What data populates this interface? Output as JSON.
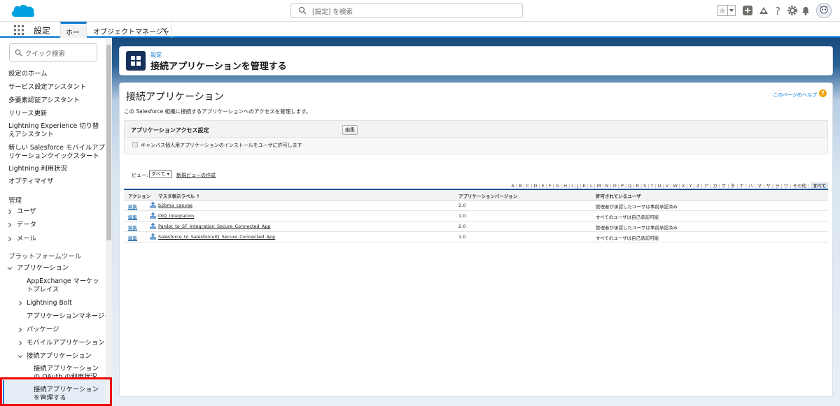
{
  "topbar": {
    "search_placeholder": "[設定] を検索"
  },
  "navbar": {
    "app_name": "設定",
    "tabs": [
      {
        "label": "ホーム"
      },
      {
        "label": "オブジェクトマネージャ"
      }
    ]
  },
  "sidebar": {
    "quick_find_placeholder": "クイック検索",
    "items": [
      {
        "label": "設定のホーム"
      },
      {
        "label": "サービス設定アシスタント"
      },
      {
        "label": "多要素認証アシスタント"
      },
      {
        "label": "リリース更新"
      },
      {
        "label": "Lightning Experience 切り替えアシスタント"
      },
      {
        "label": "新しい Salesforce モバイルアプリケーションクイックスタート"
      },
      {
        "label": "Lightning 利用状況"
      },
      {
        "label": "オプティマイザ"
      }
    ],
    "section_admin": "管理",
    "admin_items": [
      {
        "label": "ユーザ"
      },
      {
        "label": "データ"
      },
      {
        "label": "メール"
      }
    ],
    "section_platform": "プラットフォームツール",
    "apps_label": "アプリケーション",
    "app_children": [
      {
        "label": "AppExchange マーケットプレイス"
      },
      {
        "label": "Lightning Bolt"
      },
      {
        "label": "アプリケーションマネージャ"
      },
      {
        "label": "パッケージ"
      },
      {
        "label": "モバイルアプリケーション"
      },
      {
        "label": "接続アプリケーション"
      }
    ],
    "connected_children": [
      {
        "label": "接続アプリケーションの OAuth の利用状況"
      },
      {
        "label": "接続アプリケーションを管理する"
      }
    ]
  },
  "header": {
    "breadcrumb": "設定",
    "title": "接続アプリケーションを管理する"
  },
  "content": {
    "title": "接続アプリケーション",
    "help_link": "このページのヘルプ",
    "description": "この Salesforce 組織に接続するアプリケーションへのアクセスを管理します。",
    "access_settings_title": "アプリケーションアクセス設定",
    "edit_button": "編集",
    "checkbox_label": "キャンバス個人用アプリケーションのインストールをユーザに許可します",
    "view_label": "ビュー:",
    "view_value": "すべて ▾",
    "new_view_link": "新規ビューの作成",
    "alphabet": [
      "A",
      "B",
      "C",
      "D",
      "E",
      "F",
      "G",
      "H",
      "I",
      "J",
      "K",
      "L",
      "M",
      "N",
      "O",
      "P",
      "Q",
      "R",
      "S",
      "T",
      "U",
      "V",
      "W",
      "X",
      "Y",
      "Z",
      "ア",
      "カ",
      "サ",
      "タ",
      "ナ",
      "ハ",
      "マ",
      "ヤ",
      "ラ",
      "ワ",
      "その他",
      "すべて"
    ],
    "table": {
      "headers": [
        "アクション",
        "マスタ表示ラベル ↑",
        "アプリケーションバージョン",
        "許可されているユーザ"
      ],
      "rows": [
        {
          "action": "編集",
          "label": "b2bma_canvas",
          "version": "2.0",
          "users": "管理者が承認したユーザは事前承認済み"
        },
        {
          "action": "編集",
          "label": "OIQ_Integration",
          "version": "1.0",
          "users": "すべてのユーザは自己承認可能"
        },
        {
          "action": "編集",
          "label": "Pardot_to_SF_Integration_Secure_Connected_App",
          "version": "2.0",
          "users": "管理者が承認したユーザは事前承認済み"
        },
        {
          "action": "編集",
          "label": "Salesforce_to_SalesforceIQ_Secure_Connected_App",
          "version": "1.0",
          "users": "すべてのユーザは自己承認可能"
        }
      ]
    }
  }
}
